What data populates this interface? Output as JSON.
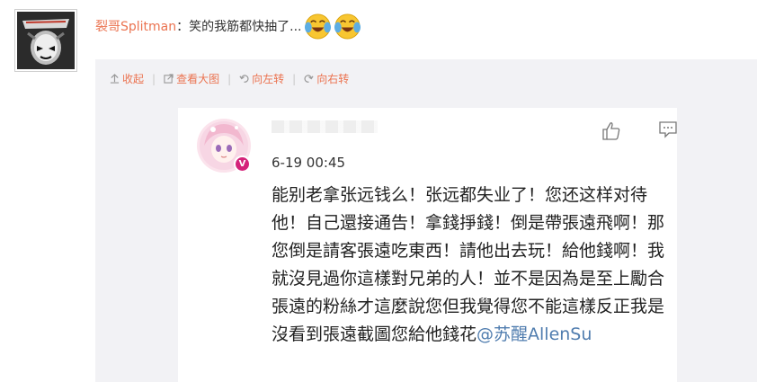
{
  "comment": {
    "author": "裂哥Splitman",
    "colon": "：",
    "text": "笑的我筋都快抽了...",
    "emojis": [
      "laugh-cry-emoji",
      "laugh-cry-emoji"
    ]
  },
  "toolbar": {
    "collapse": "收起",
    "view_large": "查看大图",
    "rotate_left": "向左转",
    "rotate_right": "向右转",
    "separator": "|"
  },
  "post": {
    "time": "6-19 00:45",
    "badge": "V",
    "body": "能别老拿张远钱么！张远都失业了！您还这样对待他！自己還接通告！拿錢掙錢！倒是帶張遠飛啊！那您倒是請客張遠吃東西！請他出去玩！給他錢啊！我就沒見過你這樣對兄弟的人！並不是因為是至上勵合張遠的粉絲才這麼說您但我覺得您不能這樣反正我是沒看到張遠截圖您給他錢花",
    "mention": "@苏醒AllenSu"
  },
  "colors": {
    "link": "#eb7350",
    "mention": "#507daf",
    "badge": "#d4237a",
    "panel_bg": "#f2f2f5"
  }
}
